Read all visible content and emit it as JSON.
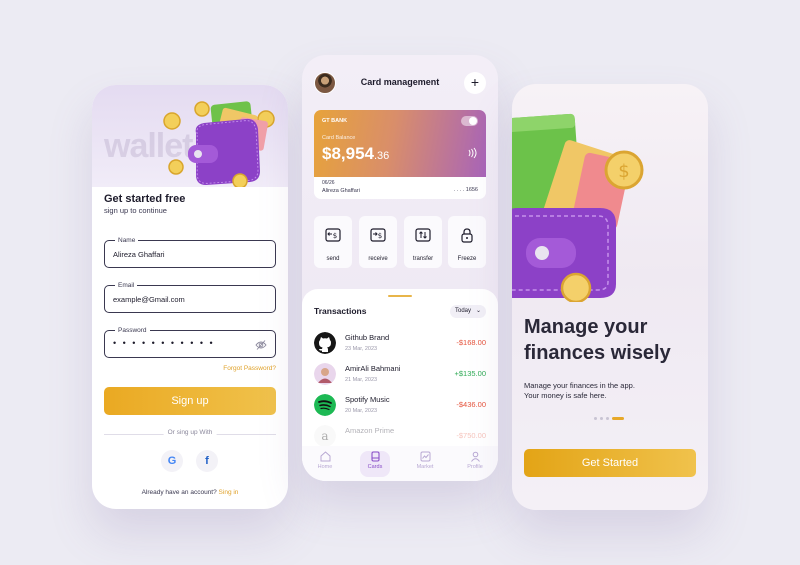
{
  "signup": {
    "bg_word": "wallet",
    "title": "Get started free",
    "subtitle": "sign up to continue",
    "name_label": "Name",
    "name_value": "Alireza Ghaffari",
    "email_label": "Email",
    "email_value": "example@Gmail.com",
    "password_label": "Password",
    "password_value": "• • • • • • • • • • •",
    "forgot_label": "Forgot Password?",
    "signup_button": "Sign up",
    "or_text": "Or sing up With",
    "google_letter": "G",
    "facebook_letter": "f",
    "have_account": "Already have an account?",
    "signin_link": "Sing in"
  },
  "cards": {
    "title": "Card management",
    "plus": "+",
    "card": {
      "bank": "GT BANK",
      "balance_label": "Card Balance",
      "balance": "$8,954",
      "balance_cents": ".36",
      "expiry": "06/26",
      "holder": "Alireza Ghaffari",
      "number": ". . . .  1656"
    },
    "actions": [
      {
        "label": "send",
        "icon": "send-dollar-icon"
      },
      {
        "label": "receive",
        "icon": "receive-dollar-icon"
      },
      {
        "label": "transfer",
        "icon": "transfer-icon"
      },
      {
        "label": "Freeze",
        "icon": "lock-icon"
      }
    ],
    "transactions_title": "Transactions",
    "filter": "Today",
    "transactions": [
      {
        "name": "Github Brand",
        "date": "23 Mar, 2023",
        "amount": "-$168.00"
      },
      {
        "name": "AmirAli Bahmani",
        "date": "21 Mar, 2023",
        "amount": "+$135.00"
      },
      {
        "name": "Spotify Music",
        "date": "20 Mar, 2023",
        "amount": "-$436.00"
      },
      {
        "name": "Amazon Prime",
        "date": "",
        "amount": "-$750.00"
      }
    ],
    "tabs": [
      "Home",
      "Cards",
      "Market",
      "Profile"
    ],
    "active_tab": "Cards"
  },
  "onboarding": {
    "headline_line1": "Manage your",
    "headline_line2": "finances wisely",
    "desc_line1": "Manage your finances in the app.",
    "desc_line2": "Your money is safe here.",
    "pages": 4,
    "active_page": 4,
    "start_button": "Get Started"
  },
  "colors": {
    "accent": "#E7A828",
    "brand_purple": "#8A4FC8",
    "negative": "#E5533C",
    "positive": "#2FAA55"
  }
}
